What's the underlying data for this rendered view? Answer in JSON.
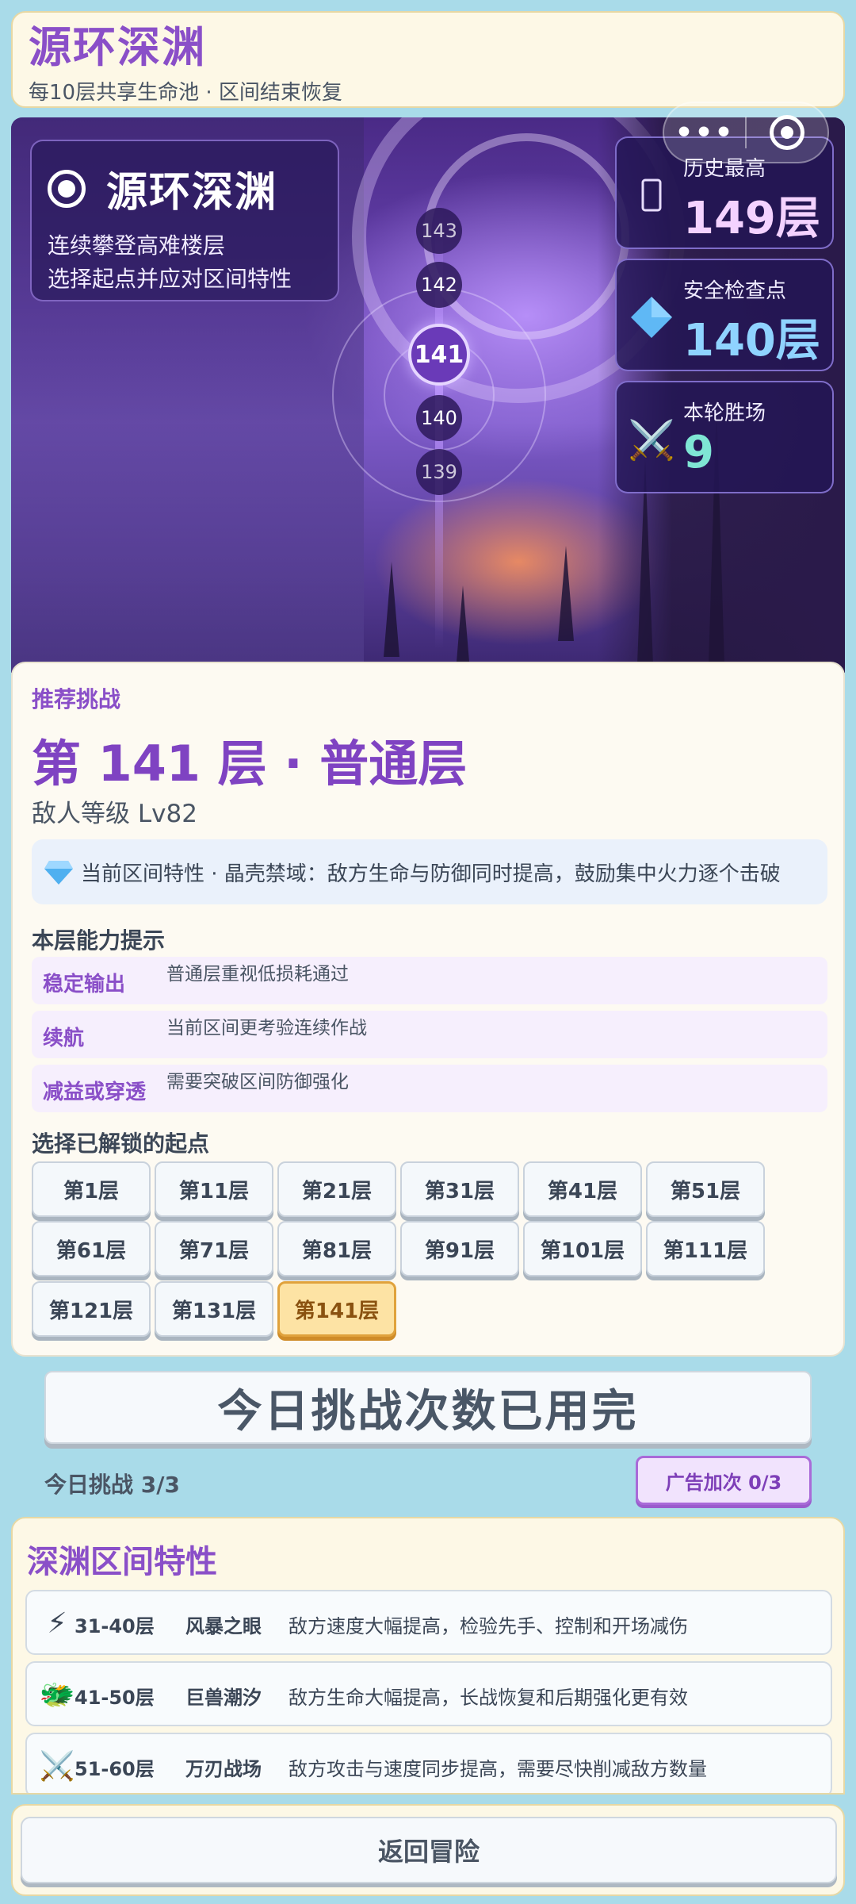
{
  "header": {
    "title": "源环深渊",
    "subtitle": "每10层共享生命池 · 区间结束恢复"
  },
  "capsule": {
    "more_label": "•••"
  },
  "banner": {
    "card_title": "源环深渊",
    "card_desc_1": "连续攀登高难楼层",
    "card_desc_2": "选择起点并应对区间特性",
    "floors": [
      "143",
      "142",
      "141",
      "140",
      "139"
    ],
    "current_floor": "141"
  },
  "stats": {
    "history": {
      "label": "历史最高",
      "value": "149层",
      "icon": "tower-icon",
      "color": "#f4d2ff"
    },
    "checkpoint": {
      "label": "安全检查点",
      "value": "140层",
      "icon": "diamond-icon",
      "color": "#8fd3ff"
    },
    "wins": {
      "label": "本轮胜场",
      "value": "9",
      "icon": "crossed-swords-icon",
      "color": "#7fe6d4"
    }
  },
  "recommend": {
    "label": "推荐挑战",
    "floor_title": "第 141 层 · 普通层",
    "enemy_level": "敌人等级  Lv82",
    "zone_trait": "当前区间特性 · 晶壳禁域：敌方生命与防御同时提高，鼓励集中火力逐个击破",
    "hints_title": "本层能力提示",
    "hints": [
      {
        "key": "稳定输出",
        "value": "普通层重视低损耗通过"
      },
      {
        "key": "续航",
        "value": "当前区间更考验连续作战"
      },
      {
        "key": "减益或穿透",
        "value": "需要突破区间防御强化"
      }
    ],
    "start_title": "选择已解锁的起点",
    "starts": [
      "第1层",
      "第11层",
      "第21层",
      "第31层",
      "第41层",
      "第51层",
      "第61层",
      "第71层",
      "第81层",
      "第91层",
      "第101层",
      "第111层",
      "第121层",
      "第131层",
      "第141层"
    ],
    "selected_start": "第141层"
  },
  "actions": {
    "main_button": "今日挑战次数已用完",
    "daily_count": "今日挑战 3/3",
    "ad_button": "广告加次 0/3"
  },
  "abyss": {
    "title": "深渊区间特性",
    "zones": [
      {
        "icon": "lightning-icon",
        "range": "31-40层",
        "name": "风暴之眼",
        "desc": "敌方速度大幅提高，检验先手、控制和开场减伤"
      },
      {
        "icon": "dragon-icon",
        "range": "41-50层",
        "name": "巨兽潮汐",
        "desc": "敌方生命大幅提高，长战恢复和后期强化更有效"
      },
      {
        "icon": "crossed-swords-icon",
        "range": "51-60层",
        "name": "万刃战场",
        "desc": "敌方攻击与速度同步提高，需要尽快削减敌方数量"
      }
    ]
  },
  "bottom": {
    "back_button": "返回冒险"
  }
}
